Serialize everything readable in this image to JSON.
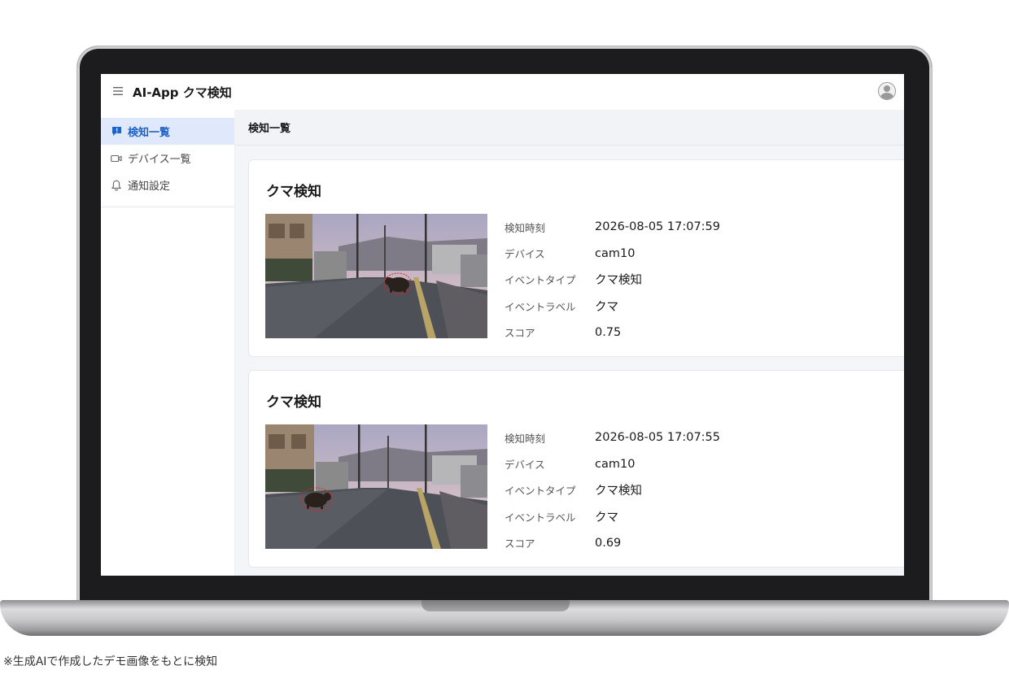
{
  "app": {
    "title": "AI-App クマ検知",
    "menu_icon": "hamburger-icon",
    "avatar_icon": "user-icon"
  },
  "sidebar": {
    "items": [
      {
        "label": "検知一覧",
        "icon": "alert-message-icon",
        "active": true
      },
      {
        "label": "デバイス一覧",
        "icon": "camera-icon",
        "active": false
      },
      {
        "label": "通知設定",
        "icon": "bell-icon",
        "active": false
      }
    ]
  },
  "page": {
    "title": "検知一覧"
  },
  "detections": [
    {
      "title": "クマ検知",
      "fields": [
        {
          "label": "検知時刻",
          "value": "2026-08-05 17:07:59"
        },
        {
          "label": "デバイス",
          "value": "cam10"
        },
        {
          "label": "イベントタイプ",
          "value": "クマ検知"
        },
        {
          "label": "イベントラベル",
          "value": "クマ"
        },
        {
          "label": "スコア",
          "value": "0.75"
        }
      ]
    },
    {
      "title": "クマ検知",
      "fields": [
        {
          "label": "検知時刻",
          "value": "2026-08-05 17:07:55"
        },
        {
          "label": "デバイス",
          "value": "cam10"
        },
        {
          "label": "イベントタイプ",
          "value": "クマ検知"
        },
        {
          "label": "イベントラベル",
          "value": "クマ"
        },
        {
          "label": "スコア",
          "value": "0.69"
        }
      ]
    }
  ],
  "footnote": "※生成AIで作成したデモ画像をもとに検知",
  "colors": {
    "accent": "#1f63c6",
    "active_bg": "#dfe9fb",
    "detection_box": "#e02020"
  }
}
